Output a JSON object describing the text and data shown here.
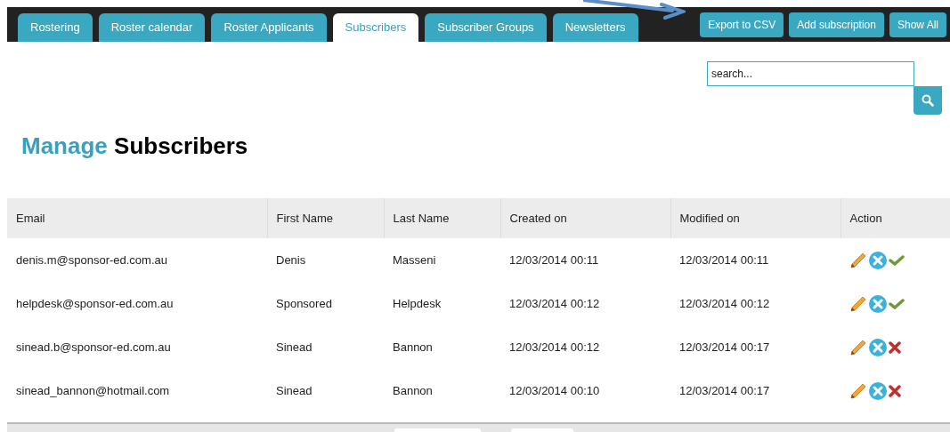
{
  "tabs": [
    {
      "label": "Rostering",
      "selected": false
    },
    {
      "label": "Roster calendar",
      "selected": false
    },
    {
      "label": "Roster Applicants",
      "selected": false
    },
    {
      "label": "Subscribers",
      "selected": true
    },
    {
      "label": "Subscriber Groups",
      "selected": false
    },
    {
      "label": "Newsletters",
      "selected": false
    }
  ],
  "toolbar_buttons": [
    "Export to CSV",
    "Add subscription",
    "Show All"
  ],
  "search": {
    "placeholder": "search..."
  },
  "heading": {
    "accent": "Manage",
    "rest": "Subscribers"
  },
  "table": {
    "columns": [
      "Email",
      "First Name",
      "Last Name",
      "Created on",
      "Modified on",
      "Action"
    ],
    "rows": [
      {
        "cells": [
          "denis.m@sponsor-ed.com.au",
          "Denis",
          "Masseni",
          "12/03/2014 00:11",
          "12/03/2014 00:11"
        ],
        "active": true
      },
      {
        "cells": [
          "helpdesk@sponsor-ed.com.au",
          "Sponsored",
          "Helpdesk",
          "12/03/2014 00:12",
          "12/03/2014 00:12"
        ],
        "active": true
      },
      {
        "cells": [
          "sinead.b@sponsor-ed.com.au",
          "Sinead",
          "Bannon",
          "12/03/2014 00:12",
          "12/03/2014 00:17"
        ],
        "active": false
      },
      {
        "cells": [
          "sinead_bannon@hotmail.com",
          "Sinead",
          "Bannon",
          "12/03/2014 00:10",
          "12/03/2014 00:17"
        ],
        "active": false
      }
    ]
  }
}
